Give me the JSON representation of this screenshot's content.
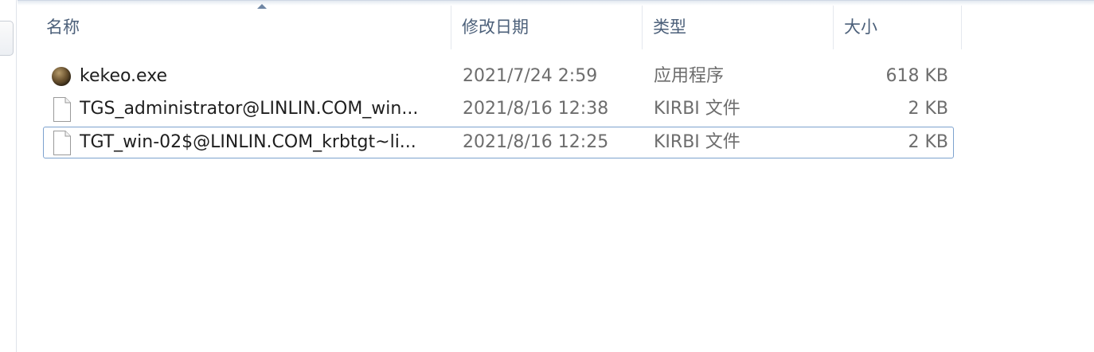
{
  "columns": {
    "name": "名称",
    "date_modified": "修改日期",
    "type": "类型",
    "size": "大小"
  },
  "sort": {
    "column": "name",
    "direction": "ascending",
    "icon": "sort-up-arrow-icon"
  },
  "files": [
    {
      "name": "kekeo.exe",
      "date_modified": "2021/7/24 2:59",
      "type": "应用程序",
      "size": "618 KB",
      "icon": "application-icon",
      "focused": false
    },
    {
      "name": "TGS_administrator@LINLIN.COM_win...",
      "date_modified": "2021/8/16 12:38",
      "type": "KIRBI 文件",
      "size": "2 KB",
      "icon": "document-icon",
      "focused": false
    },
    {
      "name": "TGT_win-02$@LINLIN.COM_krbtgt~li...",
      "date_modified": "2021/8/16 12:25",
      "type": "KIRBI 文件",
      "size": "2 KB",
      "icon": "document-icon",
      "focused": true
    }
  ],
  "colors": {
    "header_text": "#4c607a",
    "focus_border": "#7da2ce",
    "secondary_text": "#6d6d6d"
  }
}
